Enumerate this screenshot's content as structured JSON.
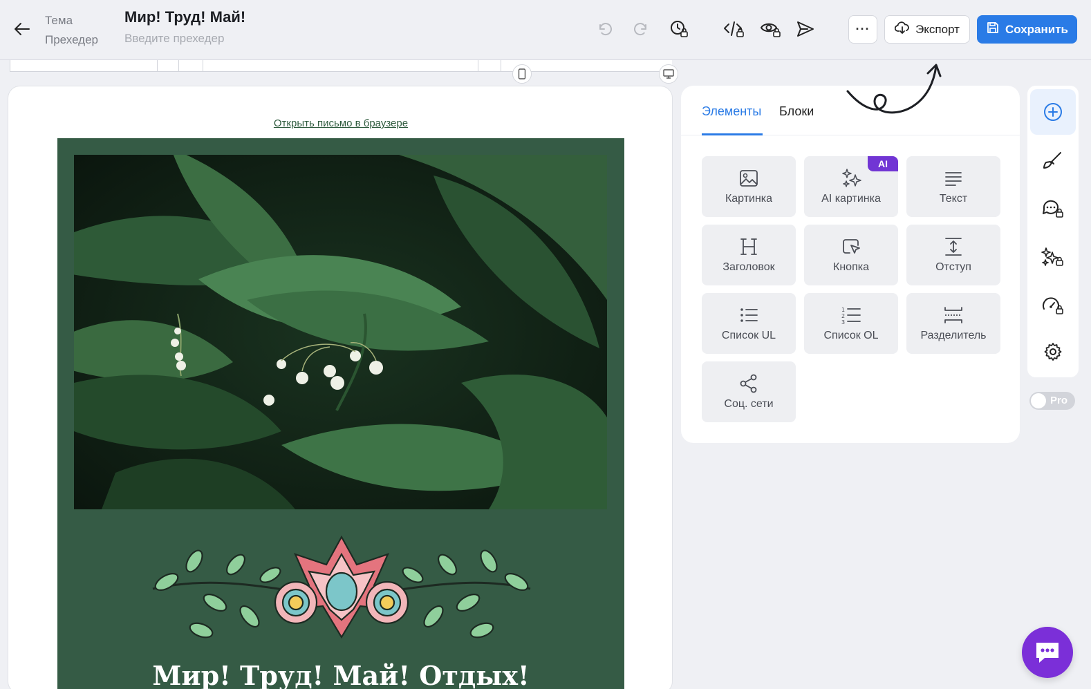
{
  "header": {
    "label_subject": "Тема",
    "label_preheader": "Прехедер",
    "subject_value": "Мир! Труд! Май!",
    "preheader_placeholder": "Введите прехедер",
    "more_label": "···",
    "export_label": "Экспорт",
    "save_label": "Сохранить"
  },
  "canvas": {
    "browser_link": "Открыть письмо в браузере",
    "email_title": "Мир! Труд! Май! Отдых!"
  },
  "panel": {
    "tabs": [
      "Элементы",
      "Блоки"
    ],
    "tiles": [
      {
        "label": "Картинка",
        "icon": "image-icon"
      },
      {
        "label": "AI картинка",
        "icon": "ai-sparkles-icon",
        "badge": "AI"
      },
      {
        "label": "Текст",
        "icon": "text-icon"
      },
      {
        "label": "Заголовок",
        "icon": "heading-icon"
      },
      {
        "label": "Кнопка",
        "icon": "button-cursor-icon"
      },
      {
        "label": "Отступ",
        "icon": "spacer-icon"
      },
      {
        "label": "Список UL",
        "icon": "bullet-list-icon"
      },
      {
        "label": "Список OL",
        "icon": "numbered-list-icon"
      },
      {
        "label": "Разделитель",
        "icon": "divider-icon"
      },
      {
        "label": "Соц. сети",
        "icon": "share-icon"
      }
    ]
  },
  "sidebar": {
    "items": [
      "add-icon",
      "brush-icon",
      "chat-lock-icon",
      "ai-lock-icon",
      "speed-lock-icon",
      "gear-icon"
    ],
    "pro_label": "Pro"
  },
  "colors": {
    "accent": "#2a7be6",
    "email_bg": "#355b45",
    "ai_badge": "#7135d4",
    "chat": "#7b2fd8"
  }
}
